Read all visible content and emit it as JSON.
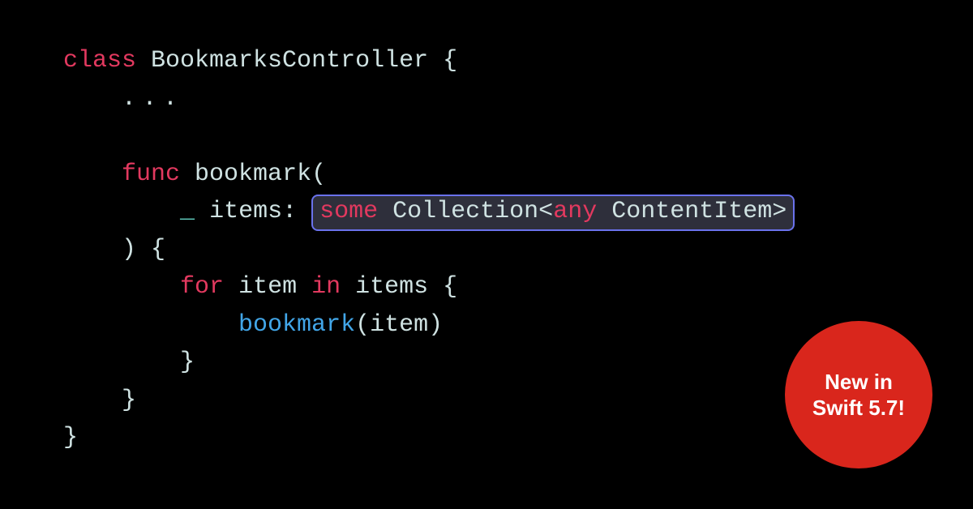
{
  "code": {
    "kw_class": "class",
    "type_name": "BookmarksController",
    "brace_open": "{",
    "dots": "...",
    "kw_func": "func",
    "func_def_name": "bookmark",
    "paren_open": "(",
    "underscore": "_",
    "param_name": "items",
    "colon": ":",
    "kw_some": "some",
    "type_collection": "Collection",
    "lt": "<",
    "kw_any": "any",
    "type_contentitem": "ContentItem",
    "gt": ">",
    "paren_close": ")",
    "brace_open2": "{",
    "kw_for": "for",
    "loop_var": "item",
    "kw_in": "in",
    "loop_collection": "items",
    "brace_open3": "{",
    "call_name": "bookmark",
    "call_paren_open": "(",
    "call_arg": "item",
    "call_paren_close": ")",
    "brace_close3": "}",
    "brace_close2": "}",
    "brace_close": "}"
  },
  "badge": {
    "line1": "New in",
    "line2": "Swift 5.7!"
  },
  "colors": {
    "background": "#000000",
    "keyword": "#e2395f",
    "type": "#cfe2e2",
    "function_call": "#42a6e8",
    "underscore": "#63d1c2",
    "highlight_bg": "#2e2f3b",
    "highlight_border": "#6a72ec",
    "badge_bg": "#d9261c",
    "badge_text": "#ffffff"
  }
}
